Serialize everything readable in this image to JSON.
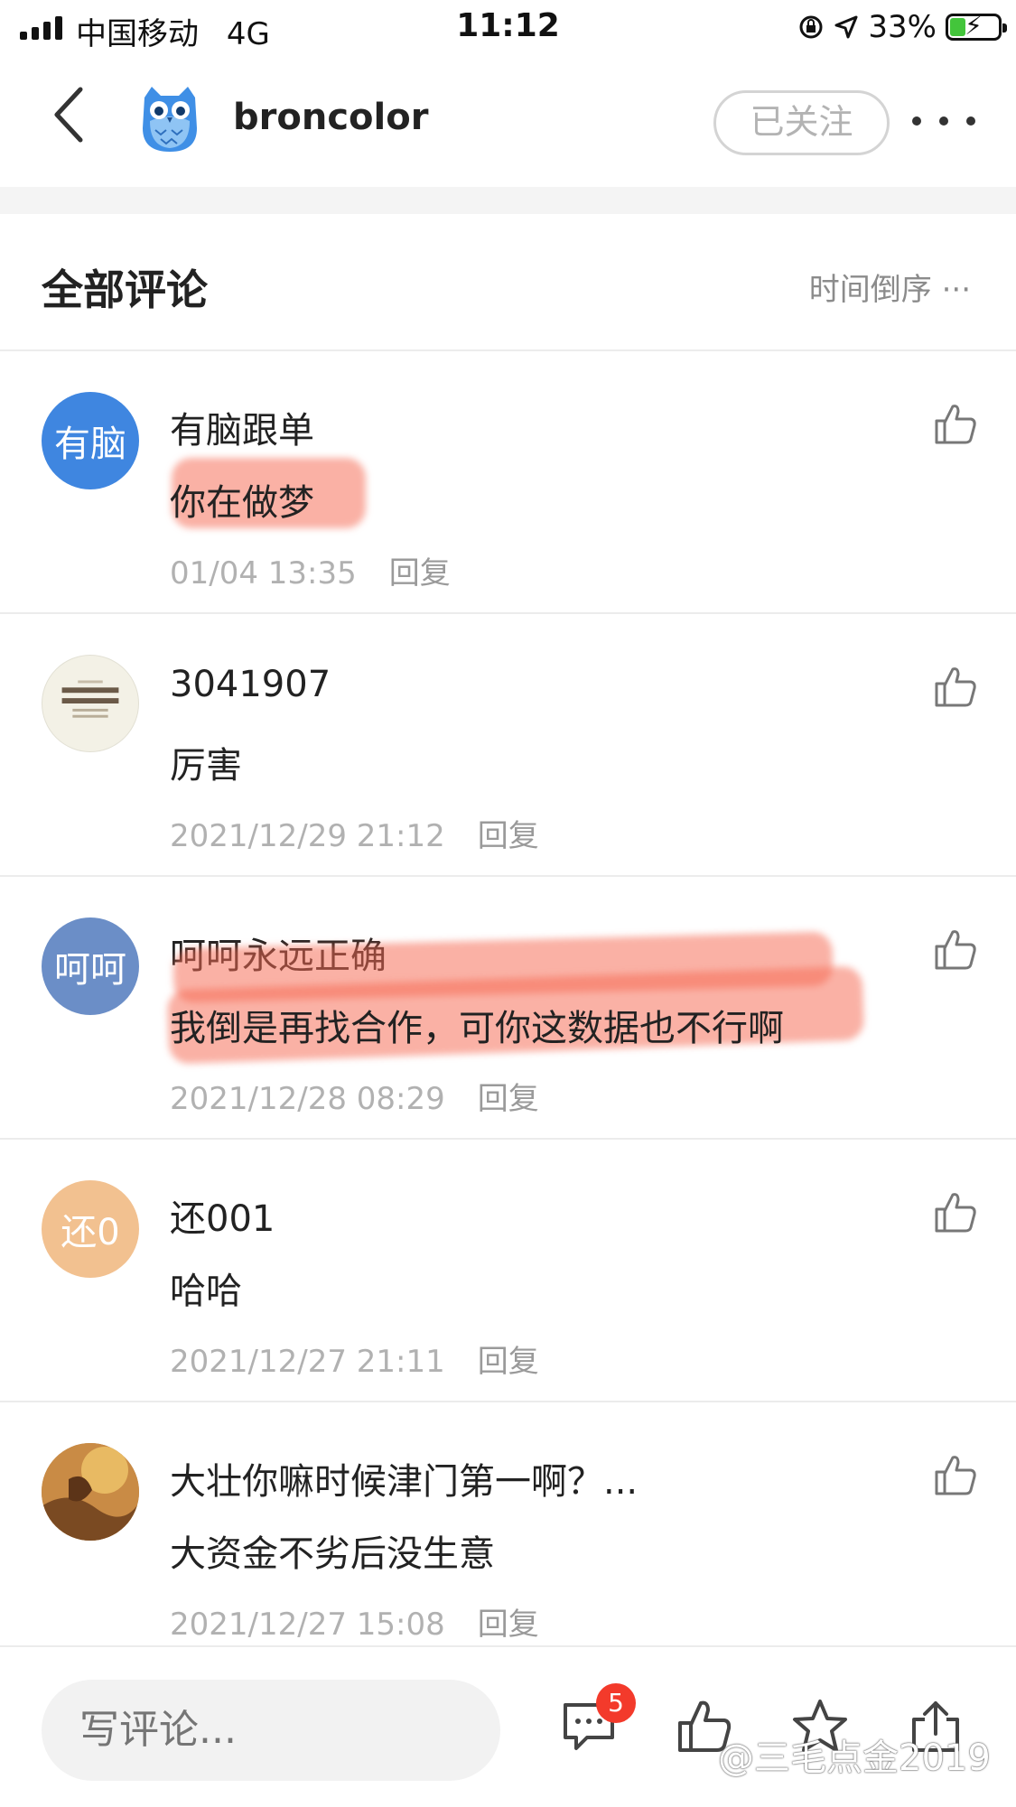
{
  "status_bar": {
    "carrier": "中国移动",
    "network": "4G",
    "time": "11:12",
    "battery": "33%",
    "battery_level": 0.33,
    "accent_charging": "#43c53b"
  },
  "header": {
    "profile_name": "broncolor",
    "follow_label": "已关注",
    "back_icon": "chevron-left-icon",
    "more_icon": "more-dots-icon",
    "avatar_icon": "owl-avatar-icon"
  },
  "section": {
    "title": "全部评论",
    "sort_label": "时间倒序 ···"
  },
  "comments": [
    {
      "avatar_text": "有脑",
      "avatar_color": "#3f86e0",
      "name": "有脑跟单",
      "text": "你在做梦",
      "time": "01/04 13:35",
      "reply": "回复",
      "highlighted": true
    },
    {
      "avatar_text": "",
      "avatar_color": "#f3f1e6",
      "name": "3041907",
      "text": "厉害",
      "time": "2021/12/29 21:12",
      "reply": "回复",
      "highlighted": false
    },
    {
      "avatar_text": "呵呵",
      "avatar_color": "#6b8ec7",
      "name": "呵呵永远正确",
      "text": "我倒是再找合作，可你这数据也不行啊",
      "time": "2021/12/28 08:29",
      "reply": "回复",
      "highlighted": true
    },
    {
      "avatar_text": "还0",
      "avatar_color": "#f2c190",
      "name": "还001",
      "text": "哈哈",
      "time": "2021/12/27 21:11",
      "reply": "回复",
      "highlighted": false
    },
    {
      "avatar_text": "",
      "avatar_color": "#b47a3c",
      "name": "大壮你嘛时候津门第一啊？...",
      "text": "大资金不劣后没生意",
      "time": "2021/12/27 15:08",
      "reply": "回复",
      "highlighted": false
    }
  ],
  "bottom_bar": {
    "comment_placeholder": "写评论...",
    "comment_count": "5",
    "watermark": "@三毛点金2019",
    "highlight_color": "#f66952"
  }
}
